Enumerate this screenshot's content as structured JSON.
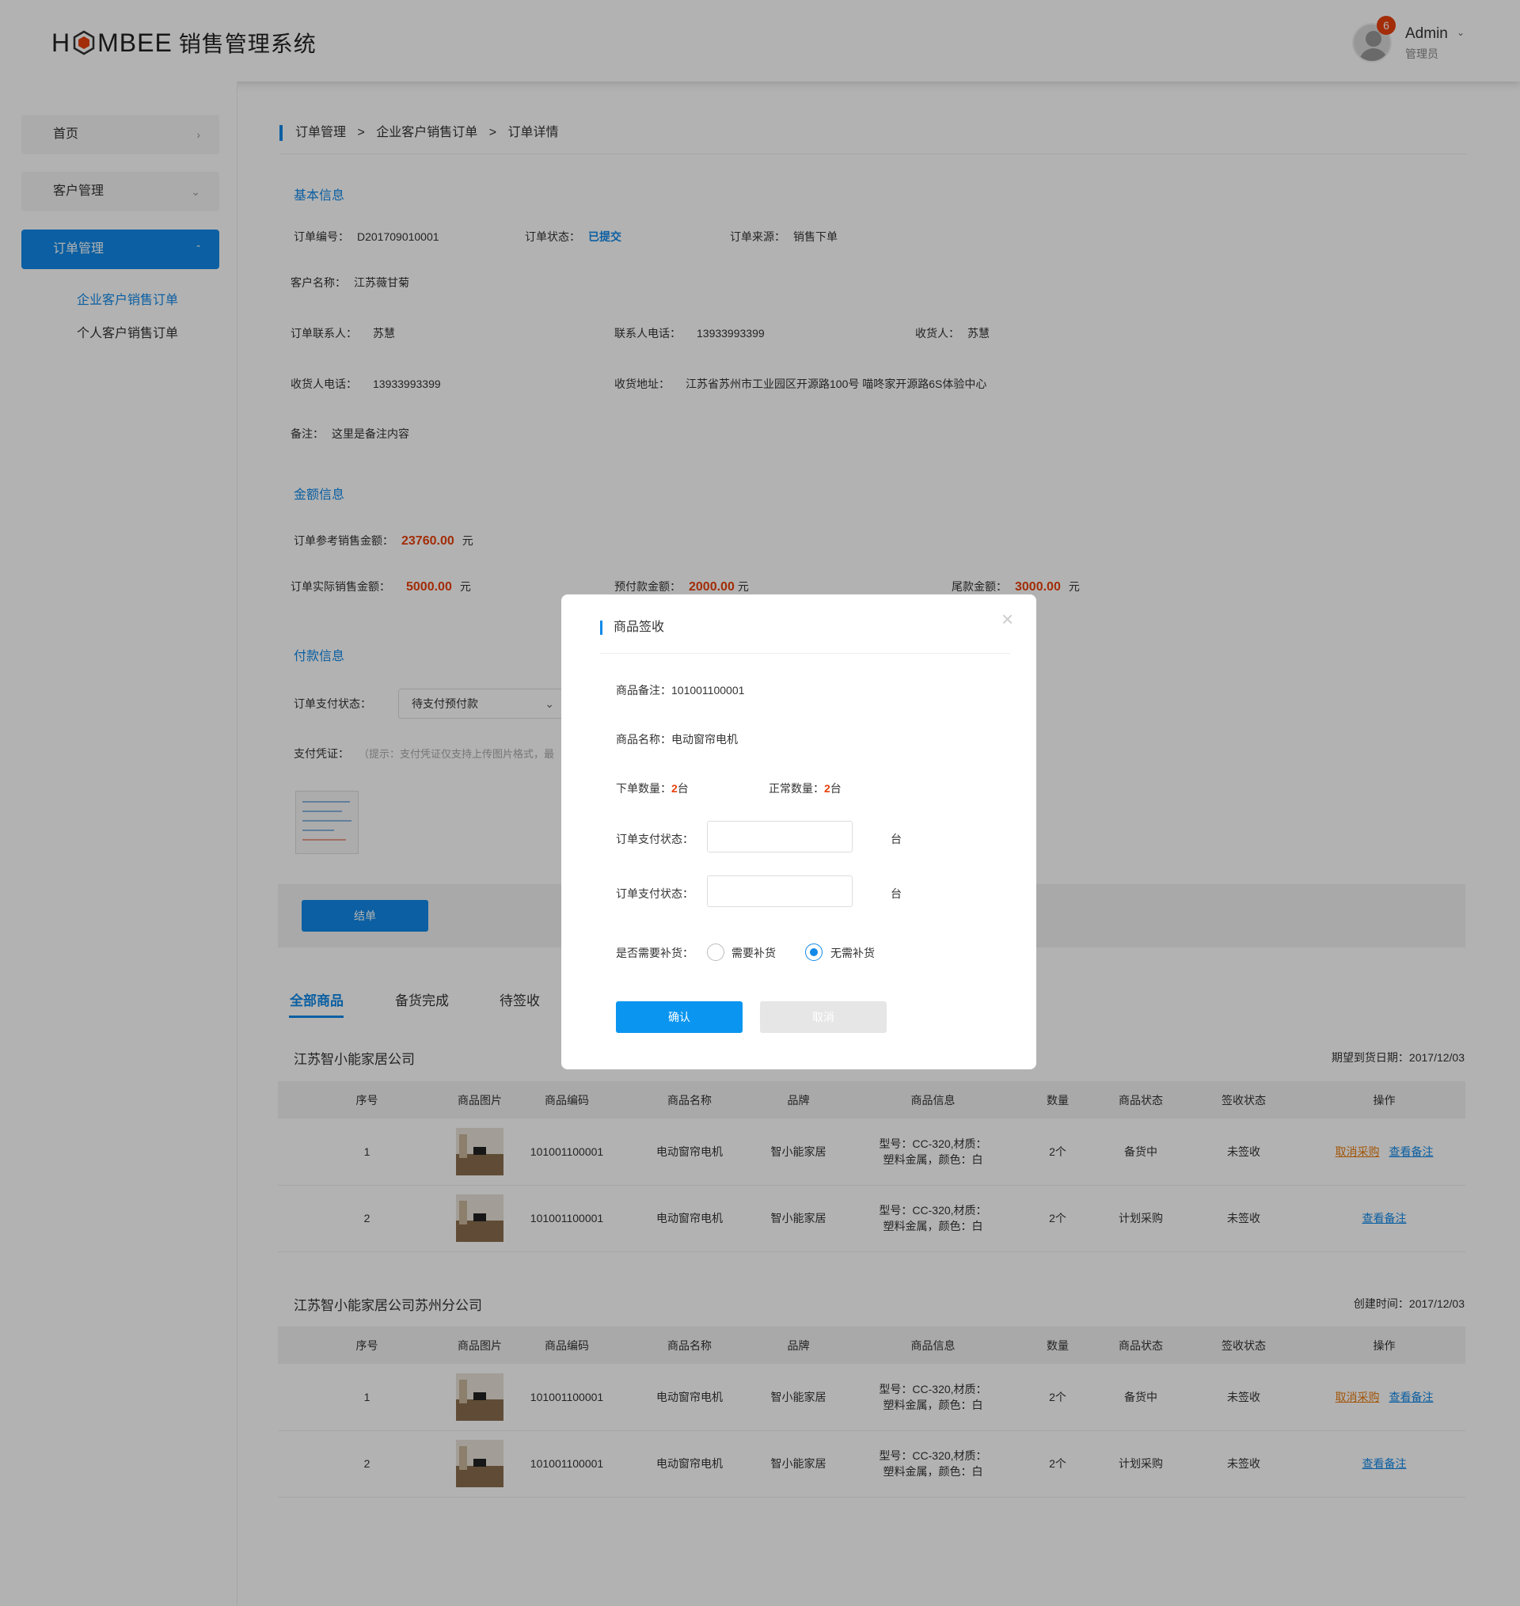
{
  "header": {
    "logo_prefix": "H",
    "logo_suffix": "MBEE",
    "logo_cn": "销售管理系统",
    "user_name": "Admin",
    "user_role": "管理员",
    "notifications": "6"
  },
  "sidebar": {
    "items": [
      {
        "label": "首页"
      },
      {
        "label": "客户管理"
      },
      {
        "label": "订单管理"
      }
    ],
    "subitems": [
      {
        "label": "企业客户销售订单"
      },
      {
        "label": "个人客户销售订单"
      }
    ]
  },
  "breadcrumb": {
    "a": "订单管理",
    "b": "企业客户销售订单",
    "c": "订单详情",
    "sep": ">"
  },
  "basic": {
    "title": "基本信息",
    "order_no_label": "订单编号：",
    "order_no": "D201709010001",
    "status_label": "订单状态：",
    "status": "已提交",
    "source_label": "订单来源：",
    "source": "销售下单",
    "customer_label": "客户名称：",
    "customer": "江苏薇甘菊",
    "contact_label": "订单联系人：",
    "contact": "苏慧",
    "contact_phone_label": "联系人电话：",
    "contact_phone": "13933993399",
    "receiver_label": "收货人：",
    "receiver": "苏慧",
    "receiver_phone_label": "收货人电话：",
    "receiver_phone": "13933993399",
    "address_label": "收货地址：",
    "address": "江苏省苏州市工业园区开源路100号 喵咚家开源路6S体验中心",
    "remark_label": "备注：",
    "remark": "这里是备注内容"
  },
  "amount": {
    "title": "金额信息",
    "ref_label": "订单参考销售金额：",
    "ref": "23760.00",
    "actual_label": "订单实际销售金额：",
    "actual": "5000.00",
    "prepay_label": "预付款金额：",
    "prepay": "2000.00",
    "balance_label": "尾款金额：",
    "balance": "3000.00",
    "unit": "元"
  },
  "payment": {
    "title": "付款信息",
    "status_label": "订单支付状态：",
    "status_value": "待支付预付款",
    "voucher_label": "支付凭证：",
    "hint": "（提示：支付凭证仅支持上传图片格式，最"
  },
  "actions": {
    "finish": "结单"
  },
  "tabs": [
    {
      "label": "全部商品"
    },
    {
      "label": "备货完成"
    },
    {
      "label": "待签收"
    }
  ],
  "groups": [
    {
      "company": "江苏智小能家居公司",
      "date": "期望到货日期：2017/12/03",
      "rows": [
        {
          "no": "1",
          "code": "101001100001",
          "name": "电动窗帘电机",
          "brand": "智小能家居",
          "info1": "型号：CC-320,材质：",
          "info2": "塑料金属，颜色：白",
          "qty": "2个",
          "state": "备货中",
          "sign": "未签收",
          "op1": "取消采购",
          "op2": "查看备注"
        },
        {
          "no": "2",
          "code": "101001100001",
          "name": "电动窗帘电机",
          "brand": "智小能家居",
          "info1": "型号：CC-320,材质：",
          "info2": "塑料金属，颜色：白",
          "qty": "2个",
          "state": "计划采购",
          "sign": "未签收",
          "op1": "",
          "op2": "查看备注"
        }
      ]
    },
    {
      "company": "江苏智小能家居公司苏州分公司",
      "date": "创建时间：2017/12/03",
      "rows": [
        {
          "no": "1",
          "code": "101001100001",
          "name": "电动窗帘电机",
          "brand": "智小能家居",
          "info1": "型号：CC-320,材质：",
          "info2": "塑料金属，颜色：白",
          "qty": "2个",
          "state": "备货中",
          "sign": "未签收",
          "op1": "取消采购",
          "op2": "查看备注"
        },
        {
          "no": "2",
          "code": "101001100001",
          "name": "电动窗帘电机",
          "brand": "智小能家居",
          "info1": "型号：CC-320,材质：",
          "info2": "塑料金属，颜色：白",
          "qty": "2个",
          "state": "计划采购",
          "sign": "未签收",
          "op1": "",
          "op2": "查看备注"
        }
      ]
    }
  ],
  "table_headers": [
    "序号",
    "商品图片",
    "商品编码",
    "商品名称",
    "品牌",
    "商品信息",
    "数量",
    "商品状态",
    "签收状态",
    "操作"
  ],
  "modal": {
    "title": "商品签收",
    "close": "×",
    "remark_label": "商品备注：",
    "remark": "101001100001",
    "name_label": "商品名称：",
    "name": "电动窗帘电机",
    "order_qty_label": "下单数量：",
    "order_qty_num": "2",
    "order_qty_unit": "台",
    "normal_qty_label": "正常数量：",
    "normal_qty_num": "2",
    "normal_qty_unit": "台",
    "field1_label": "订单支付状态：",
    "field1_unit": "台",
    "field2_label": "订单支付状态：",
    "field2_unit": "台",
    "restock_label": "是否需要补货：",
    "opt_need": "需要补货",
    "opt_no": "无需补货",
    "confirm": "确认",
    "cancel": "取消"
  }
}
